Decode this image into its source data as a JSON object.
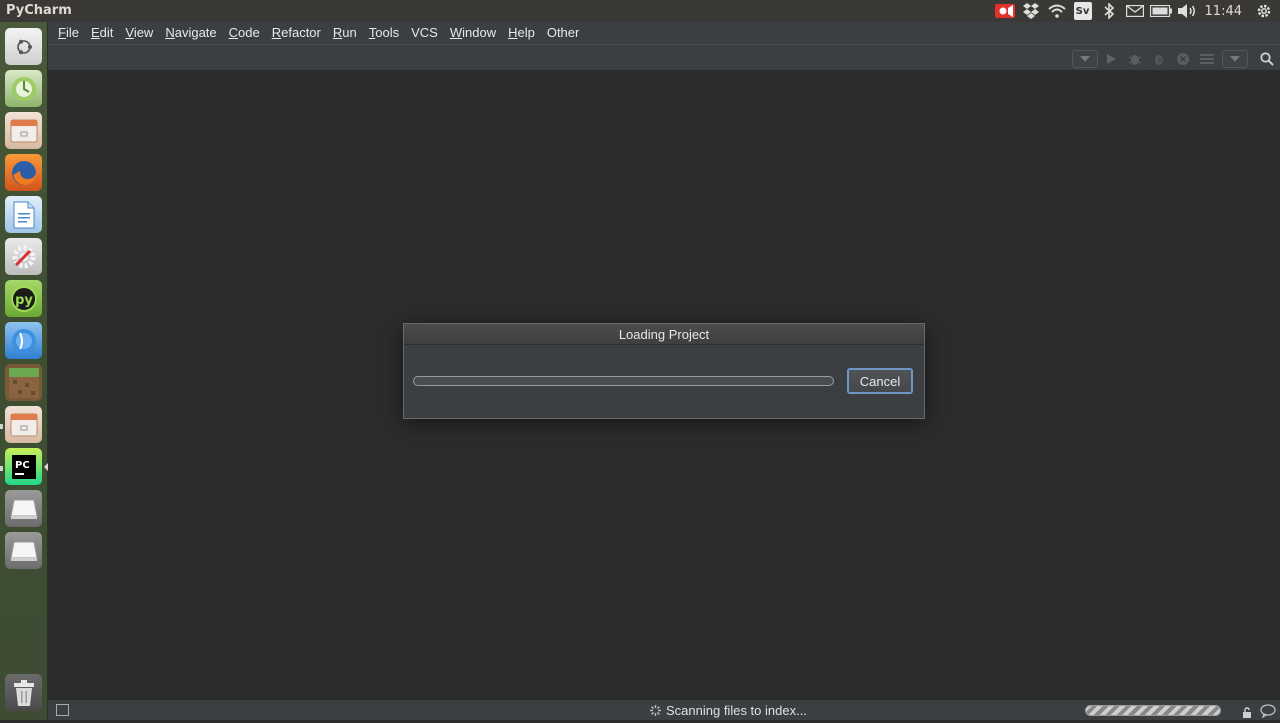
{
  "window": {
    "title": "PyCharm"
  },
  "tray": {
    "clock": "11:44",
    "keyboard_layout": "Sv"
  },
  "menubar": {
    "items": [
      {
        "mnemonic": "F",
        "rest": "ile"
      },
      {
        "mnemonic": "E",
        "rest": "dit"
      },
      {
        "mnemonic": "V",
        "rest": "iew"
      },
      {
        "mnemonic": "N",
        "rest": "avigate"
      },
      {
        "mnemonic": "C",
        "rest": "ode"
      },
      {
        "mnemonic": "R",
        "rest": "efactor"
      },
      {
        "mnemonic": "R",
        "rest": "un"
      },
      {
        "mnemonic": "T",
        "rest": "ools"
      },
      {
        "mnemonic": "",
        "rest": "VCS"
      },
      {
        "mnemonic": "W",
        "rest": "indow"
      },
      {
        "mnemonic": "H",
        "rest": "elp"
      },
      {
        "mnemonic": "",
        "rest": "Other"
      }
    ]
  },
  "dialog": {
    "title": "Loading Project",
    "cancel_label": "Cancel",
    "progress": 0
  },
  "statusbar": {
    "text": "Scanning files to index..."
  },
  "launcher": {
    "items": [
      "ubuntu-dash-icon",
      "system-update-icon",
      "files-icon",
      "firefox-icon",
      "libreoffice-writer-icon",
      "system-settings-icon",
      "pycharm-edu-icon",
      "software-center-icon",
      "minecraft-icon",
      "files-icon-2",
      "pycharm-icon",
      "drive-icon-1",
      "drive-icon-2",
      "trash-icon"
    ]
  },
  "colors": {
    "accent": "#6f95c4",
    "background": "#2b2d2c",
    "panel": "#3c3f41"
  }
}
